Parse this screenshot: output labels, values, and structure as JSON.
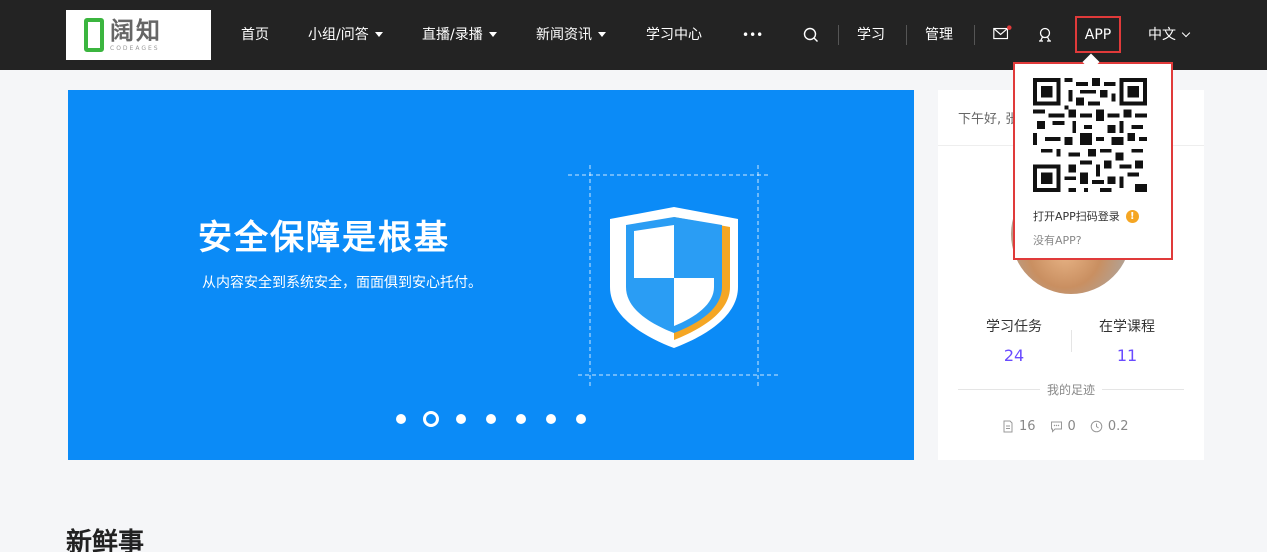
{
  "nav": {
    "logo_name": "阔知",
    "logo_sub": "CODEAGES",
    "home": "首页",
    "groups": "小组/问答",
    "live": "直播/录播",
    "news": "新闻资讯",
    "learning_center": "学习中心",
    "more": "•••",
    "study": "学习",
    "manage": "管理",
    "app": "APP",
    "lang": "中文"
  },
  "banner": {
    "title": "安全保障是根基",
    "subtitle": "从内容安全到系统安全，面面俱到安心托付。",
    "slides_total": 7,
    "active_slide": 2
  },
  "profile": {
    "greeting": "下午好, 张",
    "tasks_label": "学习任务",
    "tasks_value": "24",
    "courses_label": "在学课程",
    "courses_value": "11",
    "footprint_label": "我的足迹",
    "notes_count": "16",
    "comments_count": "0",
    "hours_count": "0.2"
  },
  "qr_popup": {
    "title": "打开APP扫码登录",
    "help": "没有APP?",
    "warn_icon": "!"
  },
  "section": {
    "title": "新鲜事"
  },
  "colors": {
    "topbar": "#232323",
    "banner": "#0b8bf7",
    "accent": "#6a4bff",
    "highlight": "#e03a3a",
    "logo_green": "#3bb53f"
  }
}
